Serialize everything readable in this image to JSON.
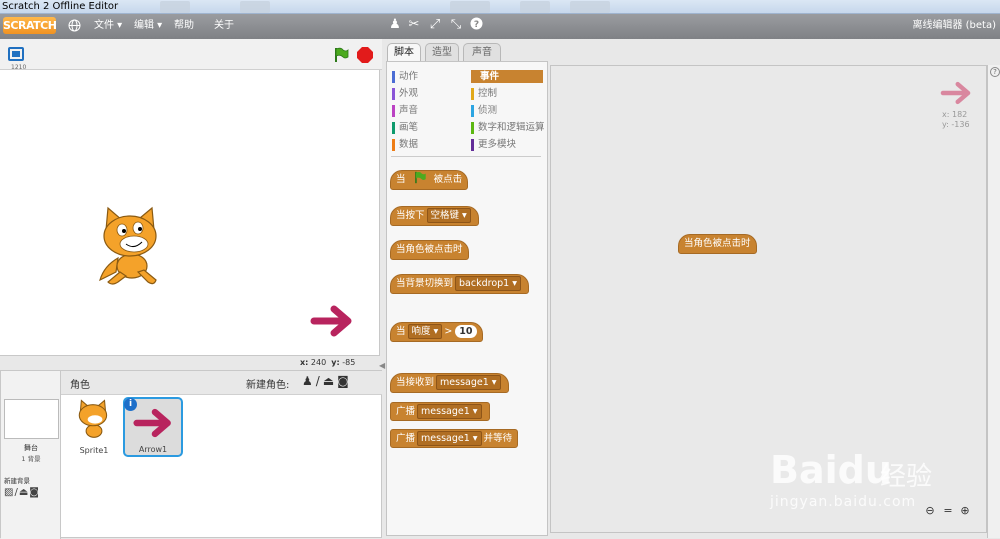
{
  "window": {
    "title": "Scratch 2 Offline Editor"
  },
  "menubar": {
    "logo": "SCRATCH",
    "file": "文件",
    "edit": "编辑",
    "help": "帮助",
    "about": "关于",
    "editor_name": "离线编辑器 (beta)"
  },
  "stage": {
    "size_label": "1210",
    "mouse_x_label": "x:",
    "mouse_x": "240",
    "mouse_y_label": "y:",
    "mouse_y": "-85"
  },
  "sprites": {
    "header": "角色",
    "new_sprite": "新建角色:",
    "stage_label": "舞台",
    "backdrop_count": "1 背景",
    "new_backdrop": "新建背景",
    "items": [
      {
        "name": "Sprite1"
      },
      {
        "name": "Arrow1"
      }
    ]
  },
  "tabs": [
    {
      "label": "脚本"
    },
    {
      "label": "造型"
    },
    {
      "label": "声音"
    }
  ],
  "categories": [
    {
      "label": "动作",
      "color": "#4a6cd4"
    },
    {
      "label": "事件",
      "color": "#c88330"
    },
    {
      "label": "外观",
      "color": "#8a55d7"
    },
    {
      "label": "控制",
      "color": "#e1a91a"
    },
    {
      "label": "声音",
      "color": "#bb42c3"
    },
    {
      "label": "侦测",
      "color": "#2ca5e2"
    },
    {
      "label": "画笔",
      "color": "#0e9a6c"
    },
    {
      "label": "数字和逻辑运算",
      "color": "#5cb712"
    },
    {
      "label": "数据",
      "color": "#ee7d16"
    },
    {
      "label": "更多模块",
      "color": "#632d99"
    }
  ],
  "blocks": {
    "when_flag_a": "当",
    "when_flag_b": "被点击",
    "when_key": "当按下",
    "key_value": "空格键",
    "when_sprite_clicked": "当角色被点击时",
    "when_backdrop": "当背景切换到",
    "backdrop_value": "backdrop1",
    "when_sensor": "当",
    "sensor_value": "响度",
    "sensor_gt": ">",
    "sensor_num": "10",
    "when_receive": "当接收到",
    "receive_value": "message1",
    "broadcast": "广播",
    "broadcast_value": "message1",
    "broadcast_wait": "广播",
    "broadcast_wait_value": "message1",
    "broadcast_wait_suffix": "并等待"
  },
  "script": {
    "placed_block": "当角色被点击时",
    "sprite_x_label": "x:",
    "sprite_x": "182",
    "sprite_y_label": "y:",
    "sprite_y": "-136"
  },
  "watermark": {
    "brand": "Bai",
    "brand2": "经验",
    "url": "jingyan.baidu.com"
  },
  "colors": {
    "events": "#c88330",
    "arrow": "#b8245e",
    "menubar": "#8c8e92"
  }
}
